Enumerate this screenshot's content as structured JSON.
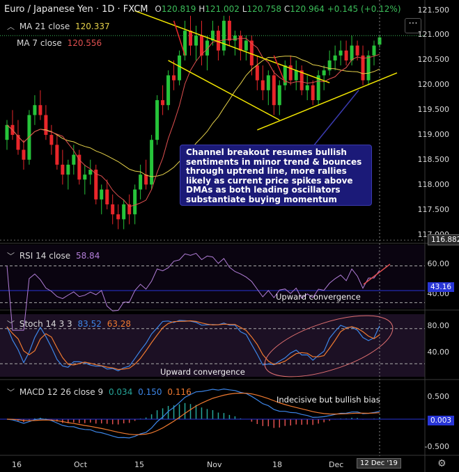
{
  "header": {
    "symbol": "Euro / Japanese Yen · 1D · FXCM",
    "o_label": "O",
    "o_value": "120.819",
    "h_label": "H",
    "h_value": "121.002",
    "l_label": "L",
    "l_value": "120.758",
    "c_label": "C",
    "c_value": "120.964",
    "change": "+0.145 (+0.12%)"
  },
  "indicators": {
    "ma21": {
      "label": "MA 21 close",
      "value": "120.337",
      "color": "#e6d24a"
    },
    "ma7": {
      "label": "MA 7 close",
      "value": "120.556",
      "color": "#e05050"
    },
    "rsi": {
      "label": "RSI 14 close",
      "value": "58.84",
      "color": "#b27ed8"
    },
    "stoch": {
      "label": "Stoch 14 3 3",
      "k": "83.52",
      "d": "63.28",
      "k_color": "#3d86e8",
      "d_color": "#f07a30"
    },
    "macd": {
      "label": "MACD 12 26 close 9",
      "hist": "0.034",
      "macd": "0.150",
      "signal": "0.116"
    }
  },
  "menu_icon": "more-icon",
  "price_axis": [
    "121.500",
    "121.000",
    "120.500",
    "120.000",
    "119.500",
    "119.000",
    "118.500",
    "118.000",
    "117.500",
    "117.000"
  ],
  "price_tag": "116.882",
  "rsi_axis": [
    "60.00",
    "40.00"
  ],
  "rsi_tag": "43.16",
  "stoch_axis": [
    "80.00",
    "40.00"
  ],
  "macd_axis": [
    "0.500",
    "-0.500"
  ],
  "macd_tag": "0.003",
  "time_axis": [
    "16",
    "Oct",
    "15",
    "Nov",
    "18",
    "Dec"
  ],
  "date_tag": "12 Dec '19",
  "annotations": {
    "callout": "Channel breakout resumes bullish sentiments in minor trend & bounces through uptrend line, more rallies likely as current price spikes above DMAs as both leading oscillators substantiate buying momentum",
    "rsi_note": "Upward convergence",
    "stoch_note": "Upward convergence",
    "macd_note": "Indecisive but bullish bias"
  },
  "chart_data": {
    "type": "candlestick",
    "title": "Euro / Japanese Yen 1D FXCM",
    "ylim": [
      116.9,
      121.6
    ],
    "colors": {
      "up": "#26c43a",
      "down": "#e8262a",
      "trendline": "#f2e600"
    },
    "candles": [
      [
        118.9,
        119.3,
        118.7,
        119.2
      ],
      [
        119.2,
        119.5,
        118.9,
        119.0
      ],
      [
        119.0,
        119.3,
        118.6,
        118.7
      ],
      [
        118.7,
        118.9,
        118.3,
        118.5
      ],
      [
        118.5,
        119.5,
        118.4,
        119.4
      ],
      [
        119.4,
        119.8,
        119.2,
        119.6
      ],
      [
        119.6,
        119.9,
        119.3,
        119.4
      ],
      [
        119.4,
        119.6,
        118.9,
        119.0
      ],
      [
        119.0,
        119.2,
        118.6,
        118.8
      ],
      [
        118.8,
        119.0,
        118.3,
        118.4
      ],
      [
        118.4,
        118.7,
        118.0,
        118.2
      ],
      [
        118.2,
        118.5,
        117.9,
        118.4
      ],
      [
        118.4,
        118.8,
        118.2,
        118.6
      ],
      [
        118.6,
        118.7,
        118.0,
        118.1
      ],
      [
        118.1,
        118.4,
        117.8,
        118.2
      ],
      [
        118.2,
        118.5,
        118.0,
        118.3
      ],
      [
        118.3,
        118.4,
        117.6,
        117.7
      ],
      [
        117.7,
        118.0,
        117.4,
        117.9
      ],
      [
        117.9,
        118.1,
        117.5,
        117.6
      ],
      [
        117.6,
        117.8,
        117.2,
        117.4
      ],
      [
        117.4,
        117.6,
        117.1,
        117.3
      ],
      [
        117.3,
        117.7,
        117.1,
        117.6
      ],
      [
        117.6,
        117.8,
        117.2,
        117.4
      ],
      [
        117.4,
        118.0,
        117.2,
        117.9
      ],
      [
        117.9,
        118.4,
        117.7,
        118.2
      ],
      [
        118.2,
        118.5,
        117.9,
        118.0
      ],
      [
        118.0,
        119.0,
        117.9,
        118.9
      ],
      [
        118.9,
        119.8,
        118.8,
        119.7
      ],
      [
        119.7,
        120.0,
        119.4,
        119.6
      ],
      [
        119.6,
        120.3,
        119.5,
        120.2
      ],
      [
        120.2,
        120.5,
        119.9,
        120.1
      ],
      [
        120.1,
        120.7,
        120.0,
        120.6
      ],
      [
        120.6,
        121.3,
        120.5,
        121.1
      ],
      [
        121.1,
        121.4,
        120.6,
        120.8
      ],
      [
        120.8,
        121.2,
        120.5,
        121.0
      ],
      [
        121.0,
        121.3,
        120.4,
        120.6
      ],
      [
        120.6,
        121.0,
        120.3,
        120.9
      ],
      [
        120.9,
        121.3,
        120.8,
        121.1
      ],
      [
        121.1,
        121.2,
        120.5,
        120.7
      ],
      [
        120.7,
        121.4,
        120.6,
        121.3
      ],
      [
        121.3,
        121.4,
        120.8,
        120.9
      ],
      [
        120.9,
        121.1,
        120.6,
        121.0
      ],
      [
        121.0,
        121.1,
        120.5,
        120.7
      ],
      [
        120.7,
        121.0,
        120.5,
        120.9
      ],
      [
        120.9,
        121.0,
        120.2,
        120.4
      ],
      [
        120.4,
        120.6,
        119.9,
        120.1
      ],
      [
        120.1,
        120.4,
        119.7,
        119.9
      ],
      [
        119.9,
        120.3,
        119.6,
        120.2
      ],
      [
        120.2,
        120.3,
        119.4,
        119.6
      ],
      [
        119.6,
        120.1,
        119.4,
        120.0
      ],
      [
        120.0,
        120.5,
        119.9,
        120.4
      ],
      [
        120.4,
        120.6,
        120.0,
        120.1
      ],
      [
        120.1,
        120.5,
        119.9,
        120.3
      ],
      [
        120.3,
        120.4,
        119.8,
        119.9
      ],
      [
        119.9,
        120.2,
        119.7,
        120.0
      ],
      [
        120.0,
        120.1,
        119.6,
        119.7
      ],
      [
        119.7,
        120.3,
        119.6,
        120.2
      ],
      [
        120.2,
        120.4,
        119.9,
        120.3
      ],
      [
        120.3,
        120.7,
        120.2,
        120.5
      ],
      [
        120.5,
        120.8,
        120.3,
        120.6
      ],
      [
        120.6,
        120.9,
        120.4,
        120.7
      ],
      [
        120.7,
        120.9,
        120.4,
        120.5
      ],
      [
        120.5,
        121.0,
        120.4,
        120.8
      ],
      [
        120.8,
        120.9,
        120.5,
        120.6
      ],
      [
        120.6,
        120.8,
        120.0,
        120.1
      ],
      [
        120.1,
        120.7,
        120.0,
        120.6
      ],
      [
        120.6,
        120.9,
        120.4,
        120.8
      ],
      [
        120.819,
        121.002,
        120.758,
        120.964
      ]
    ],
    "ma21_value": 120.337,
    "ma7_value": 120.556,
    "rsi_value": 58.84,
    "stoch_k": 83.52,
    "stoch_d": 63.28,
    "macd_hist": 0.034,
    "macd_line": 0.15,
    "macd_signal": 0.116
  }
}
